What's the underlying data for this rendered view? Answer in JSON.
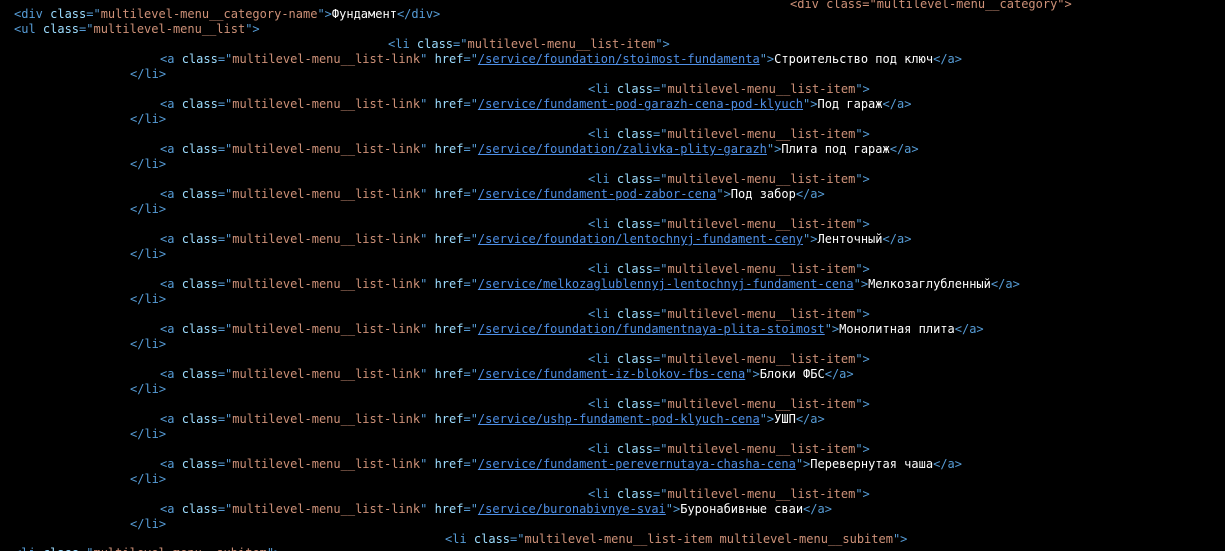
{
  "colors": {
    "background": "#000000",
    "tag": "#569cd6",
    "attr_name": "#9cdcfe",
    "attr_value": "#ce9178",
    "link": "#4f8fe6",
    "text": "#ffffff"
  },
  "lines": [
    [
      [
        "v",
        "<div class=\"multilevel-menu__category\">"
      ]
    ],
    [
      [
        "t",
        "<div "
      ],
      [
        "a",
        "class"
      ],
      [
        "t",
        "=\""
      ],
      [
        "v",
        "multilevel-menu__category-name"
      ],
      [
        "t",
        "\">"
      ],
      [
        "x",
        "Фундамент"
      ],
      [
        "t",
        "</div>"
      ]
    ],
    [
      [
        "t",
        "<ul "
      ],
      [
        "a",
        "class"
      ],
      [
        "t",
        "=\""
      ],
      [
        "v",
        "multilevel-menu__list"
      ],
      [
        "t",
        "\">"
      ]
    ],
    [
      [
        "t",
        "<li "
      ],
      [
        "a",
        "class"
      ],
      [
        "t",
        "=\""
      ],
      [
        "v",
        "multilevel-menu__list-item"
      ],
      [
        "t",
        "\">"
      ]
    ],
    [
      [
        "t",
        "<a "
      ],
      [
        "a",
        "class"
      ],
      [
        "t",
        "=\""
      ],
      [
        "v",
        "multilevel-menu__list-link"
      ],
      [
        "t",
        "\" "
      ],
      [
        "a",
        "href"
      ],
      [
        "t",
        "=\""
      ],
      [
        "u",
        "/service/foundation/stoimost-fundamenta"
      ],
      [
        "t",
        "\">"
      ],
      [
        "x",
        "Строительство под ключ"
      ],
      [
        "t",
        "</a>"
      ]
    ],
    [
      [
        "t",
        "</li>"
      ]
    ],
    [
      [
        "t",
        "<li "
      ],
      [
        "a",
        "class"
      ],
      [
        "t",
        "=\""
      ],
      [
        "v",
        "multilevel-menu__list-item"
      ],
      [
        "t",
        "\">"
      ]
    ],
    [
      [
        "t",
        "<a "
      ],
      [
        "a",
        "class"
      ],
      [
        "t",
        "=\""
      ],
      [
        "v",
        "multilevel-menu__list-link"
      ],
      [
        "t",
        "\" "
      ],
      [
        "a",
        "href"
      ],
      [
        "t",
        "=\""
      ],
      [
        "u",
        "/service/fundament-pod-garazh-cena-pod-klyuch"
      ],
      [
        "t",
        "\">"
      ],
      [
        "x",
        "Под гараж"
      ],
      [
        "t",
        "</a>"
      ]
    ],
    [
      [
        "t",
        "</li>"
      ]
    ],
    [
      [
        "t",
        "<li "
      ],
      [
        "a",
        "class"
      ],
      [
        "t",
        "=\""
      ],
      [
        "v",
        "multilevel-menu__list-item"
      ],
      [
        "t",
        "\">"
      ]
    ],
    [
      [
        "t",
        "<a "
      ],
      [
        "a",
        "class"
      ],
      [
        "t",
        "=\""
      ],
      [
        "v",
        "multilevel-menu__list-link"
      ],
      [
        "t",
        "\" "
      ],
      [
        "a",
        "href"
      ],
      [
        "t",
        "=\""
      ],
      [
        "u",
        "/service/foundation/zalivka-plity-garazh"
      ],
      [
        "t",
        "\">"
      ],
      [
        "x",
        "Плита под гараж"
      ],
      [
        "t",
        "</a>"
      ]
    ],
    [
      [
        "t",
        "</li>"
      ]
    ],
    [
      [
        "t",
        "<li "
      ],
      [
        "a",
        "class"
      ],
      [
        "t",
        "=\""
      ],
      [
        "v",
        "multilevel-menu__list-item"
      ],
      [
        "t",
        "\">"
      ]
    ],
    [
      [
        "t",
        "<a "
      ],
      [
        "a",
        "class"
      ],
      [
        "t",
        "=\""
      ],
      [
        "v",
        "multilevel-menu__list-link"
      ],
      [
        "t",
        "\" "
      ],
      [
        "a",
        "href"
      ],
      [
        "t",
        "=\""
      ],
      [
        "u",
        "/service/fundament-pod-zabor-cena"
      ],
      [
        "t",
        "\">"
      ],
      [
        "x",
        "Под забор"
      ],
      [
        "t",
        "</a>"
      ]
    ],
    [
      [
        "t",
        "</li>"
      ]
    ],
    [
      [
        "t",
        "<li "
      ],
      [
        "a",
        "class"
      ],
      [
        "t",
        "=\""
      ],
      [
        "v",
        "multilevel-menu__list-item"
      ],
      [
        "t",
        "\">"
      ]
    ],
    [
      [
        "t",
        "<a "
      ],
      [
        "a",
        "class"
      ],
      [
        "t",
        "=\""
      ],
      [
        "v",
        "multilevel-menu__list-link"
      ],
      [
        "t",
        "\" "
      ],
      [
        "a",
        "href"
      ],
      [
        "t",
        "=\""
      ],
      [
        "u",
        "/service/foundation/lentochnyj-fundament-ceny"
      ],
      [
        "t",
        "\">"
      ],
      [
        "x",
        "Ленточный"
      ],
      [
        "t",
        "</a>"
      ]
    ],
    [
      [
        "t",
        "</li>"
      ]
    ],
    [
      [
        "t",
        "<li "
      ],
      [
        "a",
        "class"
      ],
      [
        "t",
        "=\""
      ],
      [
        "v",
        "multilevel-menu__list-item"
      ],
      [
        "t",
        "\">"
      ]
    ],
    [
      [
        "t",
        "<a "
      ],
      [
        "a",
        "class"
      ],
      [
        "t",
        "=\""
      ],
      [
        "v",
        "multilevel-menu__list-link"
      ],
      [
        "t",
        "\" "
      ],
      [
        "a",
        "href"
      ],
      [
        "t",
        "=\""
      ],
      [
        "u",
        "/service/melkozaglublennyj-lentochnyj-fundament-cena"
      ],
      [
        "t",
        "\">"
      ],
      [
        "x",
        "Мелкозаглубленный"
      ],
      [
        "t",
        "</a>"
      ]
    ],
    [
      [
        "t",
        "</li>"
      ]
    ],
    [
      [
        "t",
        "<li "
      ],
      [
        "a",
        "class"
      ],
      [
        "t",
        "=\""
      ],
      [
        "v",
        "multilevel-menu__list-item"
      ],
      [
        "t",
        "\">"
      ]
    ],
    [
      [
        "t",
        "<a "
      ],
      [
        "a",
        "class"
      ],
      [
        "t",
        "=\""
      ],
      [
        "v",
        "multilevel-menu__list-link"
      ],
      [
        "t",
        "\" "
      ],
      [
        "a",
        "href"
      ],
      [
        "t",
        "=\""
      ],
      [
        "u",
        "/service/foundation/fundamentnaya-plita-stoimost"
      ],
      [
        "t",
        "\">"
      ],
      [
        "x",
        "Монолитная плита"
      ],
      [
        "t",
        "</a>"
      ]
    ],
    [
      [
        "t",
        "</li>"
      ]
    ],
    [
      [
        "t",
        "<li "
      ],
      [
        "a",
        "class"
      ],
      [
        "t",
        "=\""
      ],
      [
        "v",
        "multilevel-menu__list-item"
      ],
      [
        "t",
        "\">"
      ]
    ],
    [
      [
        "t",
        "<a "
      ],
      [
        "a",
        "class"
      ],
      [
        "t",
        "=\""
      ],
      [
        "v",
        "multilevel-menu__list-link"
      ],
      [
        "t",
        "\" "
      ],
      [
        "a",
        "href"
      ],
      [
        "t",
        "=\""
      ],
      [
        "u",
        "/service/fundament-iz-blokov-fbs-cena"
      ],
      [
        "t",
        "\">"
      ],
      [
        "x",
        "Блоки ФБС"
      ],
      [
        "t",
        "</a>"
      ]
    ],
    [
      [
        "t",
        "</li>"
      ]
    ],
    [
      [
        "t",
        "<li "
      ],
      [
        "a",
        "class"
      ],
      [
        "t",
        "=\""
      ],
      [
        "v",
        "multilevel-menu__list-item"
      ],
      [
        "t",
        "\">"
      ]
    ],
    [
      [
        "t",
        "<a "
      ],
      [
        "a",
        "class"
      ],
      [
        "t",
        "=\""
      ],
      [
        "v",
        "multilevel-menu__list-link"
      ],
      [
        "t",
        "\" "
      ],
      [
        "a",
        "href"
      ],
      [
        "t",
        "=\""
      ],
      [
        "u",
        "/service/ushp-fundament-pod-klyuch-cena"
      ],
      [
        "t",
        "\">"
      ],
      [
        "x",
        "УШП"
      ],
      [
        "t",
        "</a>"
      ]
    ],
    [
      [
        "t",
        "</li>"
      ]
    ],
    [
      [
        "t",
        "<li "
      ],
      [
        "a",
        "class"
      ],
      [
        "t",
        "=\""
      ],
      [
        "v",
        "multilevel-menu__list-item"
      ],
      [
        "t",
        "\">"
      ]
    ],
    [
      [
        "t",
        "<a "
      ],
      [
        "a",
        "class"
      ],
      [
        "t",
        "=\""
      ],
      [
        "v",
        "multilevel-menu__list-link"
      ],
      [
        "t",
        "\" "
      ],
      [
        "a",
        "href"
      ],
      [
        "t",
        "=\""
      ],
      [
        "u",
        "/service/fundament-perevernutaya-chasha-cena"
      ],
      [
        "t",
        "\">"
      ],
      [
        "x",
        "Перевернутая чаша"
      ],
      [
        "t",
        "</a>"
      ]
    ],
    [
      [
        "t",
        "</li>"
      ]
    ],
    [
      [
        "t",
        "<li "
      ],
      [
        "a",
        "class"
      ],
      [
        "t",
        "=\""
      ],
      [
        "v",
        "multilevel-menu__list-item"
      ],
      [
        "t",
        "\">"
      ]
    ],
    [
      [
        "t",
        "<a "
      ],
      [
        "a",
        "class"
      ],
      [
        "t",
        "=\""
      ],
      [
        "v",
        "multilevel-menu__list-link"
      ],
      [
        "t",
        "\" "
      ],
      [
        "a",
        "href"
      ],
      [
        "t",
        "=\""
      ],
      [
        "u",
        "/service/buronabivnye-svai"
      ],
      [
        "t",
        "\">"
      ],
      [
        "x",
        "Буронабивные сваи"
      ],
      [
        "t",
        "</a>"
      ]
    ],
    [
      [
        "t",
        "</li>"
      ]
    ],
    [
      [
        "t",
        "<li "
      ],
      [
        "a",
        "class"
      ],
      [
        "t",
        "=\""
      ],
      [
        "v",
        "multilevel-menu__list-item multilevel-menu__subitem"
      ],
      [
        "t",
        "\">"
      ]
    ],
    [
      [
        "t",
        "<li "
      ],
      [
        "a",
        "class"
      ],
      [
        "t",
        "=\""
      ],
      [
        "v",
        "multilevel-menu__subitem"
      ],
      [
        "t",
        "\">"
      ]
    ]
  ]
}
